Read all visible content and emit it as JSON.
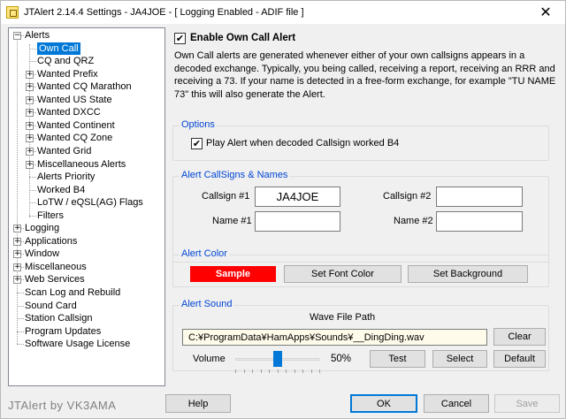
{
  "window": {
    "title": "JTAlert 2.14.4 Settings  -  JA4JOE  -  [ Logging Enabled - ADIF file ]",
    "close_glyph": "✕"
  },
  "tree": {
    "items": [
      {
        "label": "Alerts",
        "expander": "−"
      },
      {
        "label": "Own Call"
      },
      {
        "label": "CQ and QRZ"
      },
      {
        "label": "Wanted Prefix",
        "expander": "+"
      },
      {
        "label": "Wanted CQ Marathon",
        "expander": "+"
      },
      {
        "label": "Wanted US State",
        "expander": "+"
      },
      {
        "label": "Wanted DXCC",
        "expander": "+"
      },
      {
        "label": "Wanted Continent",
        "expander": "+"
      },
      {
        "label": "Wanted CQ Zone",
        "expander": "+"
      },
      {
        "label": "Wanted Grid",
        "expander": "+"
      },
      {
        "label": "Miscellaneous Alerts",
        "expander": "+"
      },
      {
        "label": "Alerts Priority"
      },
      {
        "label": "Worked B4"
      },
      {
        "label": "LoTW / eQSL(AG) Flags"
      },
      {
        "label": "Filters"
      },
      {
        "label": "Logging",
        "expander": "+"
      },
      {
        "label": "Applications",
        "expander": "+"
      },
      {
        "label": "Window",
        "expander": "+"
      },
      {
        "label": "Miscellaneous",
        "expander": "+"
      },
      {
        "label": "Web Services",
        "expander": "+"
      },
      {
        "label": "Scan Log and Rebuild"
      },
      {
        "label": "Sound Card"
      },
      {
        "label": "Station Callsign"
      },
      {
        "label": "Program Updates"
      },
      {
        "label": "Software Usage License"
      }
    ]
  },
  "panel": {
    "enable_label": "Enable Own Call Alert",
    "enable_checked": "✔",
    "description": "Own Call alerts are generated whenever either of your own callsigns appears in a decoded exchange. Typically, you being called, receiving a report, receiving an RRR and receiving a 73. If your name is detected in a free-form exchange, for example \"TU NAME 73\" this will also generate the Alert.",
    "options": {
      "title": "Options",
      "play_b4_label": "Play Alert when decoded Callsign worked B4",
      "play_b4_checked": "✔"
    },
    "callsigns": {
      "title": "Alert CallSigns & Names",
      "callsign1_label": "Callsign #1",
      "callsign1_value": "JA4JOE",
      "callsign2_label": "Callsign #2",
      "callsign2_value": "",
      "name1_label": "Name #1",
      "name1_value": "",
      "name2_label": "Name #2",
      "name2_value": ""
    },
    "color": {
      "title": "Alert Color",
      "sample_label": "Sample",
      "sample_bg": "#ff0000",
      "sample_fg": "#ffffff",
      "font_color_button": "Set Font Color",
      "background_button": "Set Background"
    },
    "sound": {
      "title": "Alert Sound",
      "wave_label": "Wave File Path",
      "wave_path": "C:¥ProgramData¥HamApps¥Sounds¥__DingDing.wav",
      "clear_button": "Clear",
      "volume_label": "Volume",
      "volume_value": "50%",
      "volume_level": 0.5,
      "test_button": "Test",
      "select_button": "Select",
      "default_button": "Default"
    }
  },
  "footer": {
    "brand": "JTAlert by VK3AMA",
    "help_button": "Help",
    "ok_button": "OK",
    "cancel_button": "Cancel",
    "save_button": "Save"
  }
}
